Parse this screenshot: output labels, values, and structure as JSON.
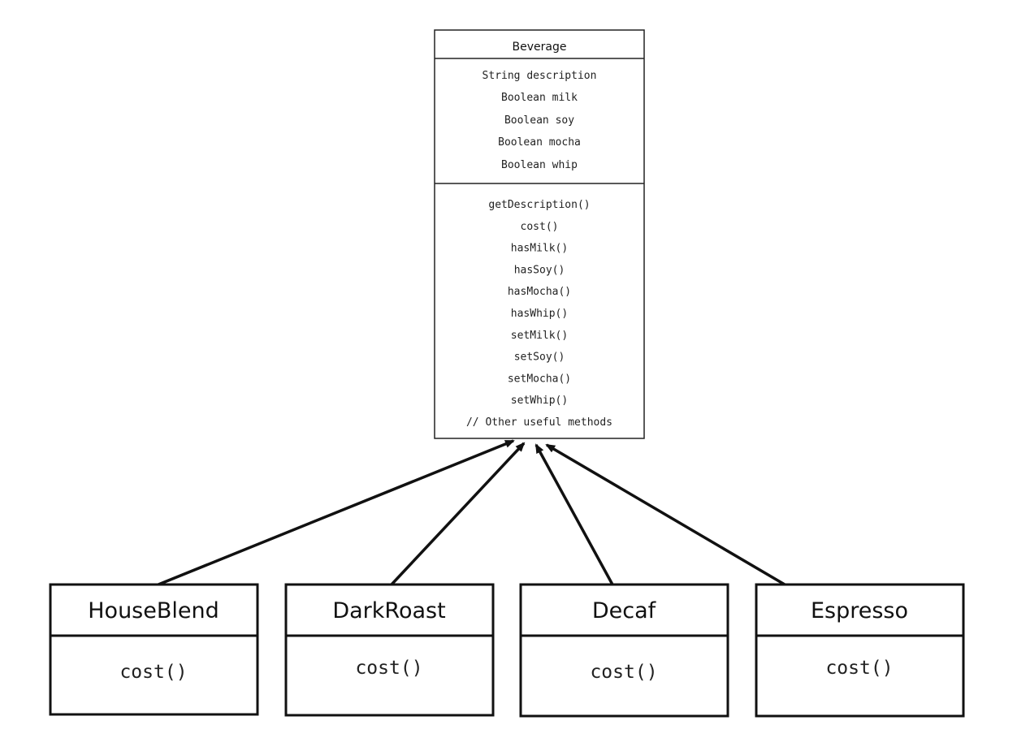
{
  "superclass": {
    "name": "Beverage",
    "attributes": [
      "String description",
      "Boolean milk",
      "Boolean soy",
      "Boolean mocha",
      "Boolean whip"
    ],
    "methods": [
      "getDescription()",
      "cost()",
      "hasMilk()",
      "hasSoy()",
      "hasMocha()",
      "hasWhip()",
      "setMilk()",
      "setSoy()",
      "setMocha()",
      "setWhip()",
      "// Other useful methods"
    ]
  },
  "subclasses": [
    {
      "name": "HouseBlend",
      "method": "cost()"
    },
    {
      "name": "DarkRoast",
      "method": "cost()"
    },
    {
      "name": "Decaf",
      "method": "cost()"
    },
    {
      "name": "Espresso",
      "method": "cost()"
    }
  ],
  "relationship": "inheritance"
}
